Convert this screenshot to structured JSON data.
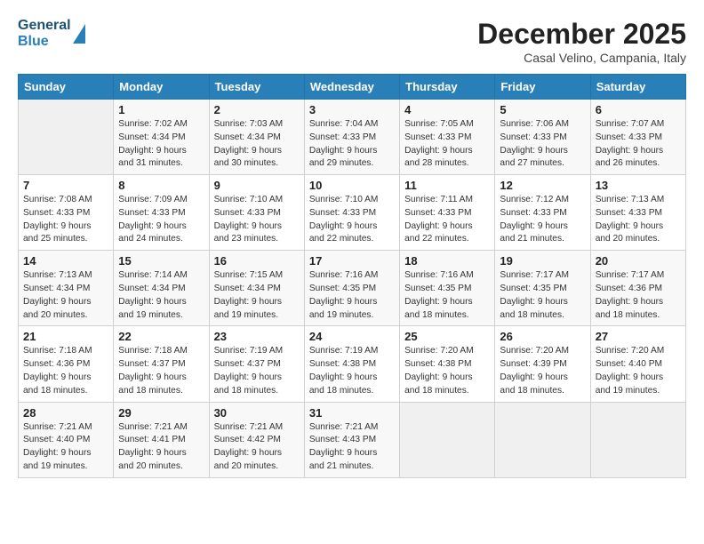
{
  "header": {
    "logo_general": "General",
    "logo_blue": "Blue",
    "month_year": "December 2025",
    "location": "Casal Velino, Campania, Italy"
  },
  "weekdays": [
    "Sunday",
    "Monday",
    "Tuesday",
    "Wednesday",
    "Thursday",
    "Friday",
    "Saturday"
  ],
  "weeks": [
    [
      {
        "day": "",
        "info": ""
      },
      {
        "day": "1",
        "info": "Sunrise: 7:02 AM\nSunset: 4:34 PM\nDaylight: 9 hours\nand 31 minutes."
      },
      {
        "day": "2",
        "info": "Sunrise: 7:03 AM\nSunset: 4:34 PM\nDaylight: 9 hours\nand 30 minutes."
      },
      {
        "day": "3",
        "info": "Sunrise: 7:04 AM\nSunset: 4:33 PM\nDaylight: 9 hours\nand 29 minutes."
      },
      {
        "day": "4",
        "info": "Sunrise: 7:05 AM\nSunset: 4:33 PM\nDaylight: 9 hours\nand 28 minutes."
      },
      {
        "day": "5",
        "info": "Sunrise: 7:06 AM\nSunset: 4:33 PM\nDaylight: 9 hours\nand 27 minutes."
      },
      {
        "day": "6",
        "info": "Sunrise: 7:07 AM\nSunset: 4:33 PM\nDaylight: 9 hours\nand 26 minutes."
      }
    ],
    [
      {
        "day": "7",
        "info": "Sunrise: 7:08 AM\nSunset: 4:33 PM\nDaylight: 9 hours\nand 25 minutes."
      },
      {
        "day": "8",
        "info": "Sunrise: 7:09 AM\nSunset: 4:33 PM\nDaylight: 9 hours\nand 24 minutes."
      },
      {
        "day": "9",
        "info": "Sunrise: 7:10 AM\nSunset: 4:33 PM\nDaylight: 9 hours\nand 23 minutes."
      },
      {
        "day": "10",
        "info": "Sunrise: 7:10 AM\nSunset: 4:33 PM\nDaylight: 9 hours\nand 22 minutes."
      },
      {
        "day": "11",
        "info": "Sunrise: 7:11 AM\nSunset: 4:33 PM\nDaylight: 9 hours\nand 22 minutes."
      },
      {
        "day": "12",
        "info": "Sunrise: 7:12 AM\nSunset: 4:33 PM\nDaylight: 9 hours\nand 21 minutes."
      },
      {
        "day": "13",
        "info": "Sunrise: 7:13 AM\nSunset: 4:33 PM\nDaylight: 9 hours\nand 20 minutes."
      }
    ],
    [
      {
        "day": "14",
        "info": "Sunrise: 7:13 AM\nSunset: 4:34 PM\nDaylight: 9 hours\nand 20 minutes."
      },
      {
        "day": "15",
        "info": "Sunrise: 7:14 AM\nSunset: 4:34 PM\nDaylight: 9 hours\nand 19 minutes."
      },
      {
        "day": "16",
        "info": "Sunrise: 7:15 AM\nSunset: 4:34 PM\nDaylight: 9 hours\nand 19 minutes."
      },
      {
        "day": "17",
        "info": "Sunrise: 7:16 AM\nSunset: 4:35 PM\nDaylight: 9 hours\nand 19 minutes."
      },
      {
        "day": "18",
        "info": "Sunrise: 7:16 AM\nSunset: 4:35 PM\nDaylight: 9 hours\nand 18 minutes."
      },
      {
        "day": "19",
        "info": "Sunrise: 7:17 AM\nSunset: 4:35 PM\nDaylight: 9 hours\nand 18 minutes."
      },
      {
        "day": "20",
        "info": "Sunrise: 7:17 AM\nSunset: 4:36 PM\nDaylight: 9 hours\nand 18 minutes."
      }
    ],
    [
      {
        "day": "21",
        "info": "Sunrise: 7:18 AM\nSunset: 4:36 PM\nDaylight: 9 hours\nand 18 minutes."
      },
      {
        "day": "22",
        "info": "Sunrise: 7:18 AM\nSunset: 4:37 PM\nDaylight: 9 hours\nand 18 minutes."
      },
      {
        "day": "23",
        "info": "Sunrise: 7:19 AM\nSunset: 4:37 PM\nDaylight: 9 hours\nand 18 minutes."
      },
      {
        "day": "24",
        "info": "Sunrise: 7:19 AM\nSunset: 4:38 PM\nDaylight: 9 hours\nand 18 minutes."
      },
      {
        "day": "25",
        "info": "Sunrise: 7:20 AM\nSunset: 4:38 PM\nDaylight: 9 hours\nand 18 minutes."
      },
      {
        "day": "26",
        "info": "Sunrise: 7:20 AM\nSunset: 4:39 PM\nDaylight: 9 hours\nand 18 minutes."
      },
      {
        "day": "27",
        "info": "Sunrise: 7:20 AM\nSunset: 4:40 PM\nDaylight: 9 hours\nand 19 minutes."
      }
    ],
    [
      {
        "day": "28",
        "info": "Sunrise: 7:21 AM\nSunset: 4:40 PM\nDaylight: 9 hours\nand 19 minutes."
      },
      {
        "day": "29",
        "info": "Sunrise: 7:21 AM\nSunset: 4:41 PM\nDaylight: 9 hours\nand 20 minutes."
      },
      {
        "day": "30",
        "info": "Sunrise: 7:21 AM\nSunset: 4:42 PM\nDaylight: 9 hours\nand 20 minutes."
      },
      {
        "day": "31",
        "info": "Sunrise: 7:21 AM\nSunset: 4:43 PM\nDaylight: 9 hours\nand 21 minutes."
      },
      {
        "day": "",
        "info": ""
      },
      {
        "day": "",
        "info": ""
      },
      {
        "day": "",
        "info": ""
      }
    ]
  ]
}
